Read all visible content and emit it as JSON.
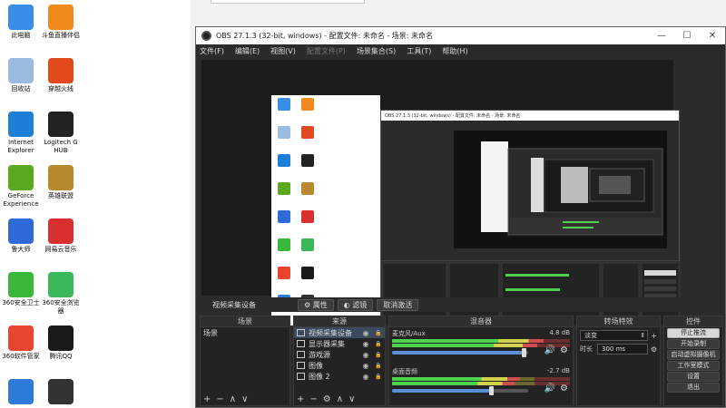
{
  "desktop": {
    "icons": [
      {
        "label": "此电脑",
        "icon": "computer-icon",
        "color": "#3a8ee6"
      },
      {
        "label": "斗鱼直播伴侣",
        "icon": "douyu-icon",
        "color": "#f08a1c"
      },
      {
        "label": "回收站",
        "icon": "recycle-bin-icon",
        "color": "#9bbbe0"
      },
      {
        "label": "穿越火线",
        "icon": "crossfire-icon",
        "color": "#e04a1c"
      },
      {
        "label": "Internet Explorer",
        "icon": "ie-icon",
        "color": "#1e7fd8"
      },
      {
        "label": "Logitech G HUB",
        "icon": "logitech-icon",
        "color": "#222222"
      },
      {
        "label": "GeForce Experience",
        "icon": "geforce-icon",
        "color": "#5aa81e"
      },
      {
        "label": "英雄联盟",
        "icon": "lol-icon",
        "color": "#b88a2e"
      },
      {
        "label": "鲁大师",
        "icon": "ludashi-icon",
        "color": "#2e6ad8"
      },
      {
        "label": "网易云音乐",
        "icon": "netease-music-icon",
        "color": "#d8302e"
      },
      {
        "label": "360安全卫士",
        "icon": "360-security-icon",
        "color": "#3ab83a"
      },
      {
        "label": "360安全浏览器",
        "icon": "360-browser-icon",
        "color": "#3ab85a"
      },
      {
        "label": "360软件管家",
        "icon": "360-software-icon",
        "color": "#e8442e"
      },
      {
        "label": "腾讯QQ",
        "icon": "qq-icon",
        "color": "#1a1a1a"
      },
      {
        "label": "",
        "icon": "monitor-icon",
        "color": "#2e7ad8"
      },
      {
        "label": "",
        "icon": "obs-icon",
        "color": "#333333"
      }
    ]
  },
  "window": {
    "title": "OBS 27.1.3 (32-bit, windows) - 配置文件: 未命名 - 场景: 未命名",
    "minimize": "—",
    "maximize": "☐",
    "close": "✕",
    "menu": [
      "文件(F)",
      "编辑(E)",
      "视图(V)",
      "配置文件(P)",
      "场景集合(S)",
      "工具(T)",
      "帮助(H)"
    ],
    "menu_disabled_index": 3
  },
  "nested": {
    "title": "OBS 27.1.3 (32-bit, windows) - 配置文件: 未命名 - 场景: 未命名"
  },
  "controlbar": {
    "source_label": "视频采集设备",
    "properties": "属性",
    "filters": "滤镜",
    "deactivate": "取消激活"
  },
  "scenes": {
    "header": "场景",
    "items": [
      "场景"
    ]
  },
  "sources": {
    "header": "来源",
    "items": [
      {
        "label": "视频采集设备",
        "icon": "camera-icon",
        "selected": true
      },
      {
        "label": "显示器采集",
        "icon": "monitor-icon",
        "selected": false
      },
      {
        "label": "游戏源",
        "icon": "gamepad-icon",
        "selected": false
      },
      {
        "label": "图像",
        "icon": "image-icon",
        "selected": false
      },
      {
        "label": "图像 2",
        "icon": "image-icon",
        "selected": false
      }
    ]
  },
  "mixer": {
    "header": "混音器",
    "channels": [
      {
        "name": "麦克风/Aux",
        "db": "4.8 dB",
        "level": 0.85,
        "volume": 0.97
      },
      {
        "name": "桌面音频",
        "db": "-2.7 dB",
        "level": 0.72,
        "volume": 0.73
      }
    ]
  },
  "transitions": {
    "header": "转场特效",
    "type": "淡变",
    "duration_label": "时长",
    "duration": "300 ms"
  },
  "controls": {
    "header": "控件",
    "buttons": [
      {
        "label": "停止推流",
        "active": true
      },
      {
        "label": "开始录制",
        "active": false
      },
      {
        "label": "启动虚拟摄像机",
        "active": false
      },
      {
        "label": "工作室模式",
        "active": false
      },
      {
        "label": "设置",
        "active": false
      },
      {
        "label": "退出",
        "active": false
      }
    ]
  },
  "footer_symbols": {
    "add": "+",
    "remove": "−",
    "up": "∧",
    "down": "∨",
    "gear": "⚙",
    "dots": "⋮"
  }
}
